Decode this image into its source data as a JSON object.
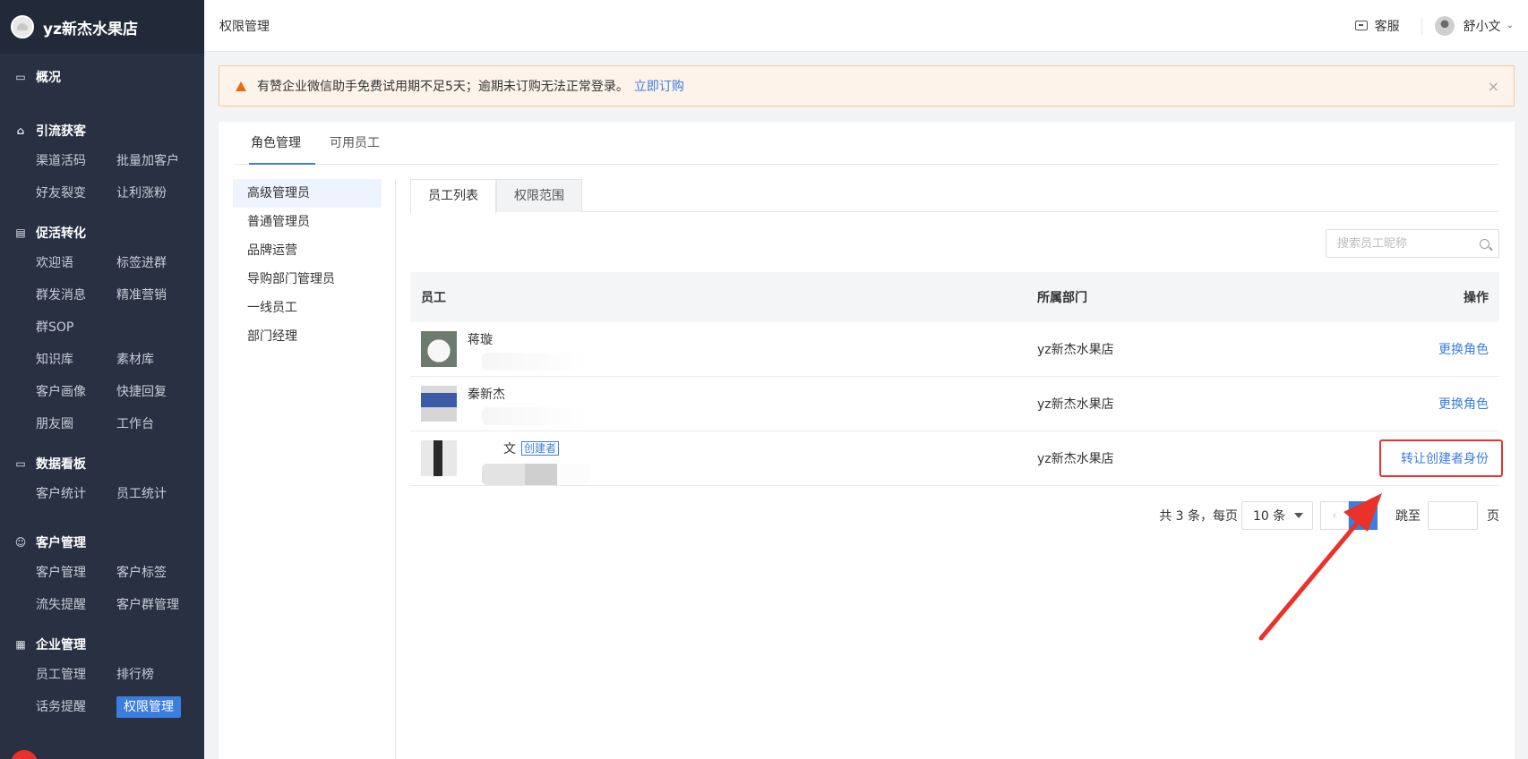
{
  "app": {
    "store_name": "yz新杰水果店"
  },
  "sidebar": {
    "groups": [
      {
        "title": "概况",
        "icon": "monitor-icon",
        "items": []
      },
      {
        "title": "引流获客",
        "icon": "store-icon",
        "items": [
          "渠道活码",
          "批量加客户",
          "好友裂变",
          "让利涨粉"
        ]
      },
      {
        "title": "促活转化",
        "icon": "calendar-icon",
        "items": [
          "欢迎语",
          "标签进群",
          "群发消息",
          "精准营销",
          "群SOP",
          "",
          "知识库",
          "素材库",
          "客户画像",
          "快捷回复",
          "朋友圈",
          "工作台"
        ]
      },
      {
        "title": "数据看板",
        "icon": "dashboard-icon",
        "items": [
          "客户统计",
          "员工统计"
        ]
      },
      {
        "title": "客户管理",
        "icon": "user-icon",
        "items": [
          "客户管理",
          "客户标签",
          "流失提醒",
          "客户群管理"
        ]
      },
      {
        "title": "企业管理",
        "icon": "building-icon",
        "items": [
          "员工管理",
          "排行榜",
          "话务提醒",
          "权限管理"
        ]
      }
    ],
    "active_item": "权限管理"
  },
  "topbar": {
    "page_title": "权限管理",
    "support_label": "客服",
    "user_name": "舒小文"
  },
  "notice": {
    "text": "有赞企业微信助手免费试用期不足5天；逾期未订购无法正常登录。",
    "link": "立即订购",
    "close": "×"
  },
  "main_tabs": [
    {
      "label": "角色管理",
      "active": true
    },
    {
      "label": "可用员工",
      "active": false
    }
  ],
  "roles": [
    "高级管理员",
    "普通管理员",
    "品牌运营",
    "导购部门管理员",
    "一线员工",
    "部门经理"
  ],
  "sub_tabs": [
    {
      "label": "员工列表",
      "active": true
    },
    {
      "label": "权限范围",
      "active": false
    }
  ],
  "search": {
    "placeholder": "搜索员工昵称"
  },
  "table": {
    "headers": {
      "employee": "员工",
      "department": "所属部门",
      "action": "操作"
    },
    "rows": [
      {
        "name": "蒋璇",
        "department": "yz新杰水果店",
        "action": "更换角色",
        "badge": ""
      },
      {
        "name": "秦新杰",
        "department": "yz新杰水果店",
        "action": "更换角色",
        "badge": ""
      },
      {
        "name": "文",
        "department": "yz新杰水果店",
        "action": "转让创建者身份",
        "badge": "创建者"
      }
    ]
  },
  "pagination": {
    "total_text": "共 3 条，每页",
    "page_size": "10 条",
    "prev": "‹",
    "current_page": "1",
    "jump_label": "跳至",
    "page_suffix": "页"
  },
  "colors": {
    "sidebar_bg": "#283042",
    "accent": "#3b7de1",
    "annotation_red": "#e8322a"
  }
}
